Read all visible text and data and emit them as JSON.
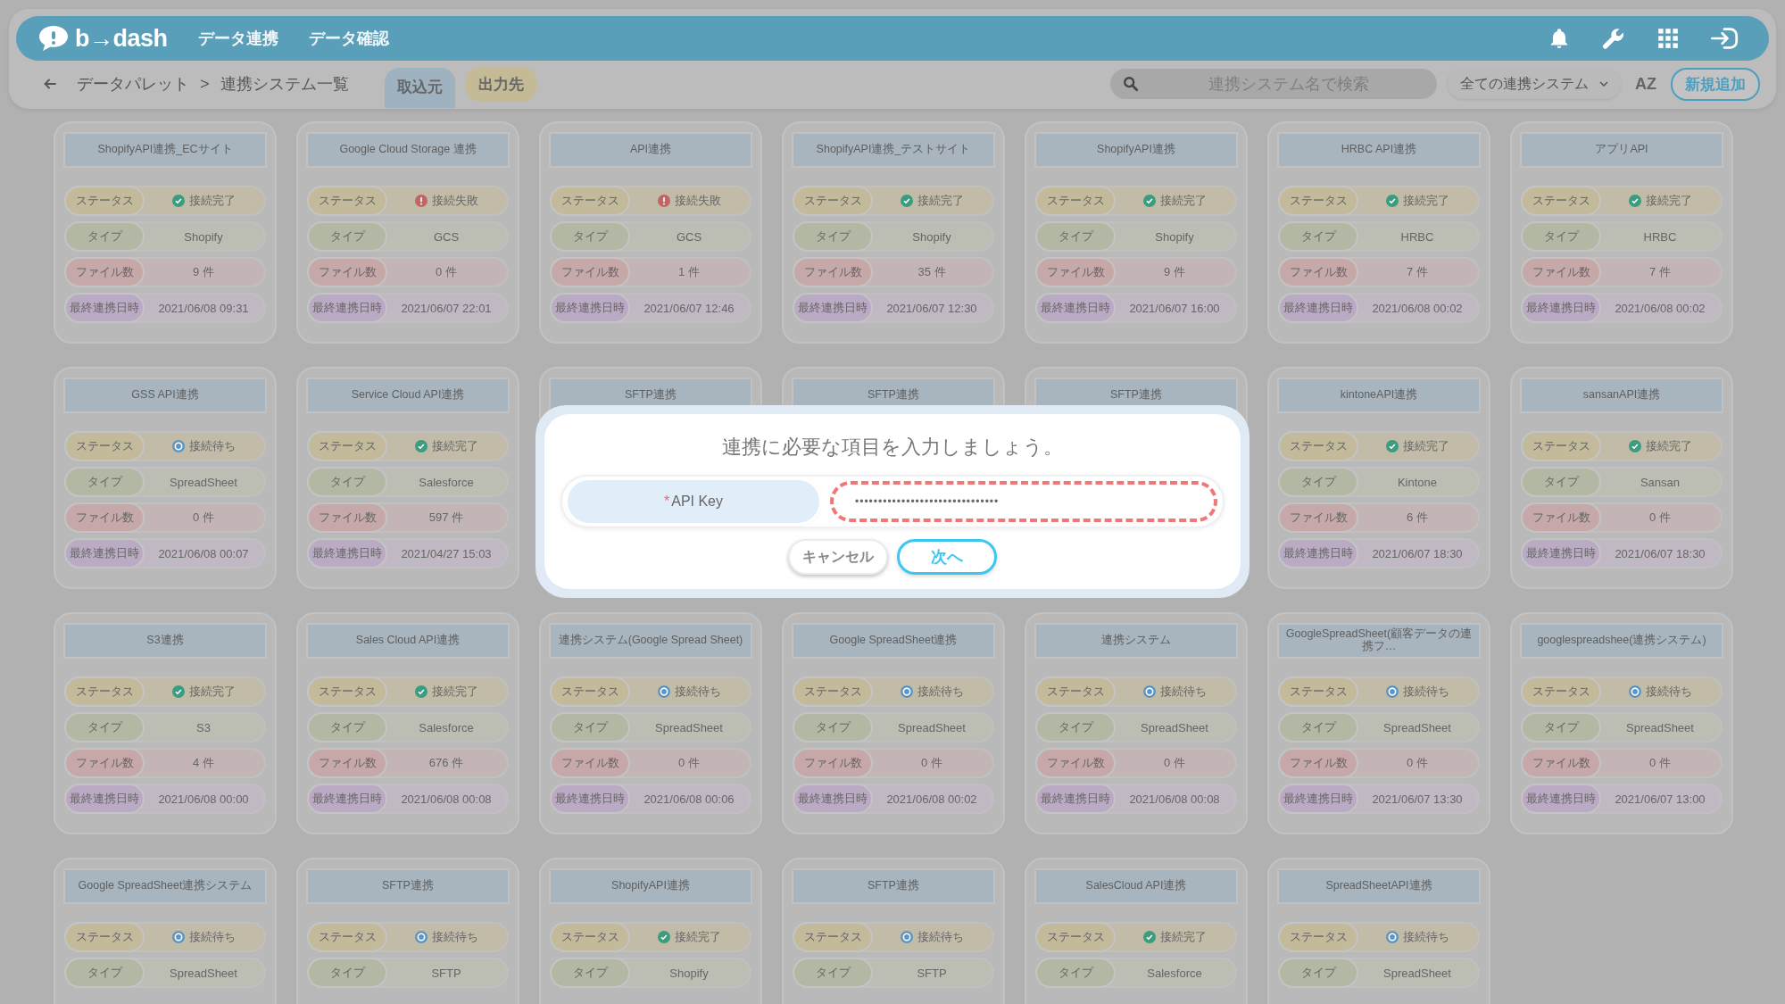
{
  "header": {
    "logo": "b→dash",
    "nav": [
      {
        "label": "データ連携"
      },
      {
        "label": "データ確認"
      }
    ]
  },
  "subnav": {
    "breadcrumb": [
      "データパレット",
      ">",
      "連携システム一覧"
    ],
    "tabs": [
      {
        "label": "取込元",
        "selected": true
      },
      {
        "label": "出力先",
        "selected": false
      }
    ],
    "search": {
      "placeholder": "連携システム名で検索"
    },
    "filter": {
      "value": "全ての連携システム"
    },
    "sort": "AZ",
    "add_button": "新規追加"
  },
  "cards": [
    {
      "title": "ShopifyAPI連携_ECサイト",
      "rows": [
        {
          "kind": "status",
          "label": "ステータス",
          "value": "接続完了",
          "icon": {
            "kind": "ok"
          }
        },
        {
          "kind": "type",
          "label": "タイプ",
          "value": "Shopify"
        },
        {
          "kind": "files",
          "label": "ファイル数",
          "value": "9 件"
        },
        {
          "kind": "date",
          "label": "最終連携日時",
          "value": "2021/06/08 09:31"
        }
      ]
    },
    {
      "title": "Google Cloud Storage 連携",
      "rows": [
        {
          "kind": "status",
          "label": "ステータス",
          "value": "接続失敗",
          "icon": {
            "kind": "error"
          }
        },
        {
          "kind": "type",
          "label": "タイプ",
          "value": "GCS"
        },
        {
          "kind": "files",
          "label": "ファイル数",
          "value": "0 件"
        },
        {
          "kind": "date",
          "label": "最終連携日時",
          "value": "2021/06/07 22:01"
        }
      ]
    },
    {
      "title": "API連携",
      "rows": [
        {
          "kind": "status",
          "label": "ステータス",
          "value": "接続失敗",
          "icon": {
            "kind": "error"
          }
        },
        {
          "kind": "type",
          "label": "タイプ",
          "value": "GCS"
        },
        {
          "kind": "files",
          "label": "ファイル数",
          "value": "1 件"
        },
        {
          "kind": "date",
          "label": "最終連携日時",
          "value": "2021/06/07 12:46"
        }
      ]
    },
    {
      "title": "ShopifyAPI連携_テストサイト",
      "rows": [
        {
          "kind": "status",
          "label": "ステータス",
          "value": "接続完了",
          "icon": {
            "kind": "ok"
          }
        },
        {
          "kind": "type",
          "label": "タイプ",
          "value": "Shopify"
        },
        {
          "kind": "files",
          "label": "ファイル数",
          "value": "35 件"
        },
        {
          "kind": "date",
          "label": "最終連携日時",
          "value": "2021/06/07 12:30"
        }
      ]
    },
    {
      "title": "ShopifyAPI連携",
      "rows": [
        {
          "kind": "status",
          "label": "ステータス",
          "value": "接続完了",
          "icon": {
            "kind": "ok"
          }
        },
        {
          "kind": "type",
          "label": "タイプ",
          "value": "Shopify"
        },
        {
          "kind": "files",
          "label": "ファイル数",
          "value": "9 件"
        },
        {
          "kind": "date",
          "label": "最終連携日時",
          "value": "2021/06/07 16:00"
        }
      ]
    },
    {
      "title": "HRBC API連携",
      "rows": [
        {
          "kind": "status",
          "label": "ステータス",
          "value": "接続完了",
          "icon": {
            "kind": "ok"
          }
        },
        {
          "kind": "type",
          "label": "タイプ",
          "value": "HRBC"
        },
        {
          "kind": "files",
          "label": "ファイル数",
          "value": "7 件"
        },
        {
          "kind": "date",
          "label": "最終連携日時",
          "value": "2021/06/08 00:02"
        }
      ]
    },
    {
      "title": "アプリAPI",
      "rows": [
        {
          "kind": "status",
          "label": "ステータス",
          "value": "接続完了",
          "icon": {
            "kind": "ok"
          }
        },
        {
          "kind": "type",
          "label": "タイプ",
          "value": "HRBC"
        },
        {
          "kind": "files",
          "label": "ファイル数",
          "value": "7 件"
        },
        {
          "kind": "date",
          "label": "最終連携日時",
          "value": "2021/06/08 00:02"
        }
      ]
    },
    {
      "title": "GSS API連携",
      "rows": [
        {
          "kind": "status",
          "label": "ステータス",
          "value": "接続待ち",
          "icon": {
            "kind": "waiting"
          }
        },
        {
          "kind": "type",
          "label": "タイプ",
          "value": "SpreadSheet"
        },
        {
          "kind": "files",
          "label": "ファイル数",
          "value": "0 件"
        },
        {
          "kind": "date",
          "label": "最終連携日時",
          "value": "2021/06/08 00:07"
        }
      ]
    },
    {
      "title": "Service Cloud API連携",
      "rows": [
        {
          "kind": "status",
          "label": "ステータス",
          "value": "接続完了",
          "icon": {
            "kind": "ok"
          }
        },
        {
          "kind": "type",
          "label": "タイプ",
          "value": "Salesforce"
        },
        {
          "kind": "files",
          "label": "ファイル数",
          "value": "597 件"
        },
        {
          "kind": "date",
          "label": "最終連携日時",
          "value": "2021/04/27 15:03"
        }
      ]
    },
    {
      "title": "SFTP連携"
    },
    {
      "title": "SFTP連携"
    },
    {
      "title": "SFTP連携"
    },
    {
      "title": "kintoneAPI連携",
      "rows": [
        {
          "kind": "status",
          "label": "ステータス",
          "value": "接続完了",
          "icon": {
            "kind": "ok"
          }
        },
        {
          "kind": "type",
          "label": "タイプ",
          "value": "Kintone"
        },
        {
          "kind": "files",
          "label": "ファイル数",
          "value": "6 件"
        },
        {
          "kind": "date",
          "label": "最終連携日時",
          "value": "2021/06/07 18:30"
        }
      ]
    },
    {
      "title": "sansanAPI連携",
      "rows": [
        {
          "kind": "status",
          "label": "ステータス",
          "value": "接続完了",
          "icon": {
            "kind": "ok"
          }
        },
        {
          "kind": "type",
          "label": "タイプ",
          "value": "Sansan"
        },
        {
          "kind": "files",
          "label": "ファイル数",
          "value": "0 件"
        },
        {
          "kind": "date",
          "label": "最終連携日時",
          "value": "2021/06/07 18:30"
        }
      ]
    },
    {
      "title": "S3連携",
      "rows": [
        {
          "kind": "status",
          "label": "ステータス",
          "value": "接続完了",
          "icon": {
            "kind": "ok"
          }
        },
        {
          "kind": "type",
          "label": "タイプ",
          "value": "S3"
        },
        {
          "kind": "files",
          "label": "ファイル数",
          "value": "4 件"
        },
        {
          "kind": "date",
          "label": "最終連携日時",
          "value": "2021/06/08 00:00"
        }
      ]
    },
    {
      "title": "Sales Cloud API連携",
      "rows": [
        {
          "kind": "status",
          "label": "ステータス",
          "value": "接続完了",
          "icon": {
            "kind": "ok"
          }
        },
        {
          "kind": "type",
          "label": "タイプ",
          "value": "Salesforce"
        },
        {
          "kind": "files",
          "label": "ファイル数",
          "value": "676 件"
        },
        {
          "kind": "date",
          "label": "最終連携日時",
          "value": "2021/06/08 00:08"
        }
      ]
    },
    {
      "title": "連携システム(Google Spread Sheet)",
      "rows": [
        {
          "kind": "status",
          "label": "ステータス",
          "value": "接続待ち",
          "icon": {
            "kind": "waiting"
          }
        },
        {
          "kind": "type",
          "label": "タイプ",
          "value": "SpreadSheet"
        },
        {
          "kind": "files",
          "label": "ファイル数",
          "value": "0 件"
        },
        {
          "kind": "date",
          "label": "最終連携日時",
          "value": "2021/06/08 00:06"
        }
      ]
    },
    {
      "title": "Google SpreadSheet連携",
      "rows": [
        {
          "kind": "status",
          "label": "ステータス",
          "value": "接続待ち",
          "icon": {
            "kind": "waiting"
          }
        },
        {
          "kind": "type",
          "label": "タイプ",
          "value": "SpreadSheet"
        },
        {
          "kind": "files",
          "label": "ファイル数",
          "value": "0 件"
        },
        {
          "kind": "date",
          "label": "最終連携日時",
          "value": "2021/06/08 00:02"
        }
      ]
    },
    {
      "title": "連携システム",
      "rows": [
        {
          "kind": "status",
          "label": "ステータス",
          "value": "接続待ち",
          "icon": {
            "kind": "waiting"
          }
        },
        {
          "kind": "type",
          "label": "タイプ",
          "value": "SpreadSheet"
        },
        {
          "kind": "files",
          "label": "ファイル数",
          "value": "0 件"
        },
        {
          "kind": "date",
          "label": "最終連携日時",
          "value": "2021/06/08 00:08"
        }
      ]
    },
    {
      "title": "GoogleSpreadSheet(顧客データの連携フ…",
      "rows": [
        {
          "kind": "status",
          "label": "ステータス",
          "value": "接続待ち",
          "icon": {
            "kind": "waiting"
          }
        },
        {
          "kind": "type",
          "label": "タイプ",
          "value": "SpreadSheet"
        },
        {
          "kind": "files",
          "label": "ファイル数",
          "value": "0 件"
        },
        {
          "kind": "date",
          "label": "最終連携日時",
          "value": "2021/06/07 13:30"
        }
      ]
    },
    {
      "title": "googlespreadshee(連携システム)",
      "rows": [
        {
          "kind": "status",
          "label": "ステータス",
          "value": "接続待ち",
          "icon": {
            "kind": "waiting"
          }
        },
        {
          "kind": "type",
          "label": "タイプ",
          "value": "SpreadSheet"
        },
        {
          "kind": "files",
          "label": "ファイル数",
          "value": "0 件"
        },
        {
          "kind": "date",
          "label": "最終連携日時",
          "value": "2021/06/07 13:00"
        }
      ]
    },
    {
      "title": "Google SpreadSheet連携システム",
      "rows": [
        {
          "kind": "status",
          "label": "ステータス",
          "value": "接続待ち",
          "icon": {
            "kind": "waiting"
          }
        },
        {
          "kind": "type",
          "label": "タイプ",
          "value": "SpreadSheet"
        }
      ]
    },
    {
      "title": "SFTP連携",
      "rows": [
        {
          "kind": "status",
          "label": "ステータス",
          "value": "接続待ち",
          "icon": {
            "kind": "waiting"
          }
        },
        {
          "kind": "type",
          "label": "タイプ",
          "value": "SFTP"
        }
      ]
    },
    {
      "title": "ShopifyAPI連携",
      "rows": [
        {
          "kind": "status",
          "label": "ステータス",
          "value": "接続完了",
          "icon": {
            "kind": "ok"
          }
        },
        {
          "kind": "type",
          "label": "タイプ",
          "value": "Shopify"
        }
      ]
    },
    {
      "title": "SFTP連携",
      "rows": [
        {
          "kind": "status",
          "label": "ステータス",
          "value": "接続待ち",
          "icon": {
            "kind": "waiting"
          }
        },
        {
          "kind": "type",
          "label": "タイプ",
          "value": "SFTP"
        }
      ]
    },
    {
      "title": "SalesCloud API連携",
      "rows": [
        {
          "kind": "status",
          "label": "ステータス",
          "value": "接続完了",
          "icon": {
            "kind": "ok"
          }
        },
        {
          "kind": "type",
          "label": "タイプ",
          "value": "Salesforce"
        }
      ]
    },
    {
      "title": "SpreadSheetAPI連携",
      "rows": [
        {
          "kind": "status",
          "label": "ステータス",
          "value": "接続待ち",
          "icon": {
            "kind": "waiting"
          }
        },
        {
          "kind": "type",
          "label": "タイプ",
          "value": "SpreadSheet"
        }
      ]
    }
  ],
  "modal": {
    "title": "連携に必要な項目を入力しましょう。",
    "field": {
      "required_mark": "*",
      "label": "API Key",
      "value": "•••••••••••••••••••••••••••••••",
      "invalid": true
    },
    "buttons": [
      {
        "kind": "cancel",
        "label": "キャンセル"
      },
      {
        "kind": "next",
        "label": "次へ"
      }
    ]
  }
}
